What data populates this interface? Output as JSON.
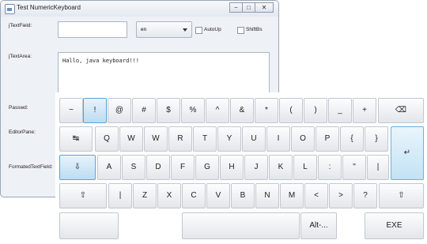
{
  "window": {
    "title": "Test NumericKeyboard",
    "controls": [
      "−",
      "□",
      "✕"
    ]
  },
  "form": {
    "labels": {
      "textfield": "jTextField:",
      "textarea": "jTextArea:",
      "passwd": "Passwd:",
      "editorpane": "EditorPane:",
      "formatted": "FormatedTextField:"
    },
    "textfield_value": "",
    "locale_selected": "en",
    "autoup_label": "AutoUp",
    "shiftbs_label": "ShiftBs",
    "textarea_value": "Hallo, java keyboard!!!"
  },
  "keyboard": {
    "row1": [
      "~",
      "!",
      "@",
      "#",
      "$",
      "%",
      "^",
      "&",
      "*",
      "(",
      ")",
      "_",
      "+"
    ],
    "backspace": "⌫",
    "tab": "↹",
    "row2": [
      "Q",
      "W",
      "W",
      "R",
      "T",
      "Y",
      "U",
      "I",
      "O",
      "P",
      "{",
      "}"
    ],
    "enter": "↵",
    "caps": "⇩",
    "row3": [
      "A",
      "S",
      "D",
      "F",
      "G",
      "H",
      "J",
      "K",
      "L",
      ":",
      "\"",
      "|"
    ],
    "shift_left": "⇧",
    "row4": [
      "|",
      "Z",
      "X",
      "C",
      "V",
      "B",
      "N",
      "M",
      "<",
      ">",
      "?"
    ],
    "shift_right": "⇧",
    "alt_label": "Alt-...",
    "exe_label": "EXE",
    "selected_key": "!"
  }
}
